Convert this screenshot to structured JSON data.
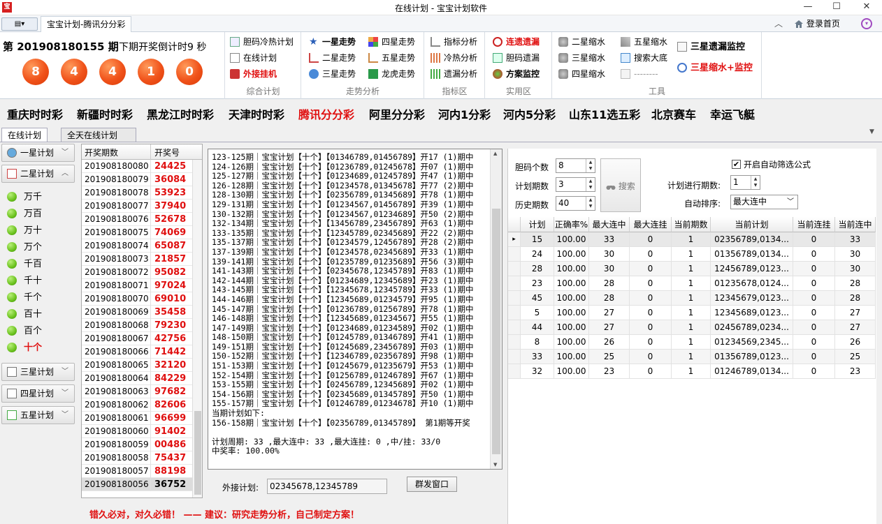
{
  "window": {
    "title": "在线计划 - 宝宝计划软件",
    "min": "—",
    "max": "☐",
    "close": "✕"
  },
  "tabs": {
    "app_menu": "▤▾",
    "main_tab": "宝宝计划-腾讯分分彩",
    "login": "登录首页",
    "collapse": "︿"
  },
  "lottery": {
    "period": "第 201908180155 期",
    "countdown": "下期开奖倒计时9 秒",
    "balls": [
      "8",
      "4",
      "4",
      "1",
      "0"
    ]
  },
  "ribbon": {
    "zonghe": {
      "label": "综合计划",
      "items": [
        "胆码冷热计划",
        "在线计划",
        "外接挂机"
      ]
    },
    "zoushi": {
      "label": "走势分析",
      "col1": [
        "一星走势",
        "二星走势",
        "三星走势"
      ],
      "col2": [
        "四星走势",
        "五星走势",
        "龙虎走势"
      ]
    },
    "zhibiao": {
      "label": "指标区",
      "items": [
        "指标分析",
        "冷热分析",
        "遗漏分析"
      ]
    },
    "shiyong": {
      "label": "实用区",
      "items": [
        "连遗遗漏",
        "胆码遗漏",
        "方案监控"
      ]
    },
    "gongju": {
      "label": "工具",
      "col1": [
        "二星缩水",
        "三星缩水",
        "四星缩水"
      ],
      "col2": [
        "五星缩水",
        "搜索大底",
        "--------"
      ],
      "col3": [
        "三星遗漏监控",
        "三星缩水+监控"
      ]
    }
  },
  "categories": [
    "重庆时时彩",
    "新疆时时彩",
    "黑龙江时时彩",
    "天津时时彩",
    "腾讯分分彩",
    "阿里分分彩",
    "河内1分彩",
    "河内5分彩",
    "山东11选五彩",
    "北京赛车",
    "幸运飞艇"
  ],
  "inner_tabs": [
    "在线计划",
    "全天在线计划"
  ],
  "nav": {
    "top": [
      "一星计划",
      "二星计划"
    ],
    "digits": [
      "万千",
      "万百",
      "万十",
      "万个",
      "千百",
      "千十",
      "千个",
      "百十",
      "百个",
      "十个"
    ],
    "bottom": [
      "三星计划",
      "四星计划",
      "五星计划"
    ]
  },
  "history": {
    "headers": [
      "开奖期数",
      "开奖号"
    ],
    "rows": [
      [
        "201908180080",
        "24425"
      ],
      [
        "201908180079",
        "36084"
      ],
      [
        "201908180078",
        "53923"
      ],
      [
        "201908180077",
        "37940"
      ],
      [
        "201908180076",
        "52678"
      ],
      [
        "201908180075",
        "74069"
      ],
      [
        "201908180074",
        "65087"
      ],
      [
        "201908180073",
        "21857"
      ],
      [
        "201908180072",
        "95082"
      ],
      [
        "201908180071",
        "97024"
      ],
      [
        "201908180070",
        "69010"
      ],
      [
        "201908180069",
        "35458"
      ],
      [
        "201908180068",
        "79230"
      ],
      [
        "201908180067",
        "42756"
      ],
      [
        "201908180066",
        "71442"
      ],
      [
        "201908180065",
        "32120"
      ],
      [
        "201908180064",
        "84229"
      ],
      [
        "201908180063",
        "97682"
      ],
      [
        "201908180062",
        "82606"
      ],
      [
        "201908180061",
        "96699"
      ],
      [
        "201908180060",
        "91402"
      ],
      [
        "201908180059",
        "00486"
      ],
      [
        "201908180058",
        "75437"
      ],
      [
        "201908180057",
        "88198"
      ],
      [
        "201908180056",
        "36752"
      ]
    ]
  },
  "plan_text": "123-125期｜宝宝计划【十个】【01346789,01456789】开17 (1)期中\n124-126期｜宝宝计划【十个】【01236789,01245678】开07 (1)期中\n125-127期｜宝宝计划【十个】【01234689,01245789】开47 (1)期中\n126-128期｜宝宝计划【十个】【01234578,01345678】开77 (2)期中\n128-130期｜宝宝计划【十个】【02356789,01345689】开78 (1)期中\n129-131期｜宝宝计划【十个】【01234567,01456789】开39 (1)期中\n130-132期｜宝宝计划【十个】【01234567,01234689】开50 (2)期中\n132-134期｜宝宝计划【十个】【13456789,23456789】开63 (1)期中\n133-135期｜宝宝计划【十个】【12345789,02345689】开22 (2)期中\n135-137期｜宝宝计划【十个】【01234579,12456789】开28 (2)期中\n137-139期｜宝宝计划【十个】【01234578,02345689】开33 (1)期中\n139-141期｜宝宝计划【十个】【01235789,01235689】开56 (3)期中\n141-143期｜宝宝计划【十个】【02345678,12345789】开83 (1)期中\n142-144期｜宝宝计划【十个】【01234689,12345689】开23 (1)期中\n143-145期｜宝宝计划【十个】【12345678,12345789】开33 (1)期中\n144-146期｜宝宝计划【十个】【12345689,01234579】开95 (1)期中\n145-147期｜宝宝计划【十个】【01236789,01256789】开78 (1)期中\n146-148期｜宝宝计划【十个】【12345689,01234567】开55 (1)期中\n147-149期｜宝宝计划【十个】【01234689,01234589】开02 (1)期中\n148-150期｜宝宝计划【十个】【01245789,01346789】开41 (1)期中\n149-151期｜宝宝计划【十个】【01245689,23456789】开03 (1)期中\n150-152期｜宝宝计划【十个】【12346789,02356789】开98 (1)期中\n151-153期｜宝宝计划【十个】【01245679,01235679】开53 (1)期中\n152-154期｜宝宝计划【十个】【01256789,01246789】开67 (1)期中\n153-155期｜宝宝计划【十个】【02456789,12345689】开02 (1)期中\n154-156期｜宝宝计划【十个】【02345689,01345789】开50 (1)期中\n155-157期｜宝宝计划【十个】【01246789,01234678】开10 (1)期中\n当期计划如下:\n156-158期｜宝宝计划【十个】【02356789,01345789】 第1期等开奖\n\n计划周期: 33 ,最大连中: 33 ,最大连挂: 0 ,中/挂: 33/0\n中奖率: 100.00%",
  "external": {
    "label": "外接计划:",
    "value": "02345678,12345789",
    "send_button": "群发窗口"
  },
  "slogan": "错久必对，对久必错！ —— 建议：研究走势分析，自己制定方案！",
  "filters": {
    "dan_count": {
      "label": "胆码个数",
      "value": "8"
    },
    "plan_periods": {
      "label": "计划期数",
      "value": "3"
    },
    "history_periods": {
      "label": "历史期数",
      "value": "40"
    },
    "search_button": "搜索",
    "auto_filter": {
      "label": "开启自动筛选公式",
      "checked": "✔"
    },
    "running_periods": {
      "label": "计划进行期数:",
      "value": "1"
    },
    "auto_sort": {
      "label": "自动排序:",
      "value": "最大连中"
    }
  },
  "grid": {
    "headers": [
      "计划",
      "正确率%",
      "最大连中",
      "最大连挂",
      "当前期数",
      "当前计划",
      "当前连挂",
      "当前连中"
    ],
    "rows": [
      [
        "15",
        "100.00",
        "33",
        "0",
        "1",
        "02356789,0134...",
        "0",
        "33"
      ],
      [
        "24",
        "100.00",
        "30",
        "0",
        "1",
        "01356789,0134...",
        "0",
        "30"
      ],
      [
        "28",
        "100.00",
        "30",
        "0",
        "1",
        "12456789,0123...",
        "0",
        "30"
      ],
      [
        "23",
        "100.00",
        "28",
        "0",
        "1",
        "01235678,0124...",
        "0",
        "28"
      ],
      [
        "45",
        "100.00",
        "28",
        "0",
        "1",
        "12345679,0123...",
        "0",
        "28"
      ],
      [
        "5",
        "100.00",
        "27",
        "0",
        "1",
        "12345689,0123...",
        "0",
        "27"
      ],
      [
        "44",
        "100.00",
        "27",
        "0",
        "1",
        "02456789,0234...",
        "0",
        "27"
      ],
      [
        "8",
        "100.00",
        "26",
        "0",
        "1",
        "01234569,2345...",
        "0",
        "26"
      ],
      [
        "33",
        "100.00",
        "25",
        "0",
        "1",
        "01356789,0123...",
        "0",
        "25"
      ],
      [
        "32",
        "100.00",
        "23",
        "0",
        "1",
        "01246789,0134...",
        "0",
        "23"
      ]
    ]
  }
}
